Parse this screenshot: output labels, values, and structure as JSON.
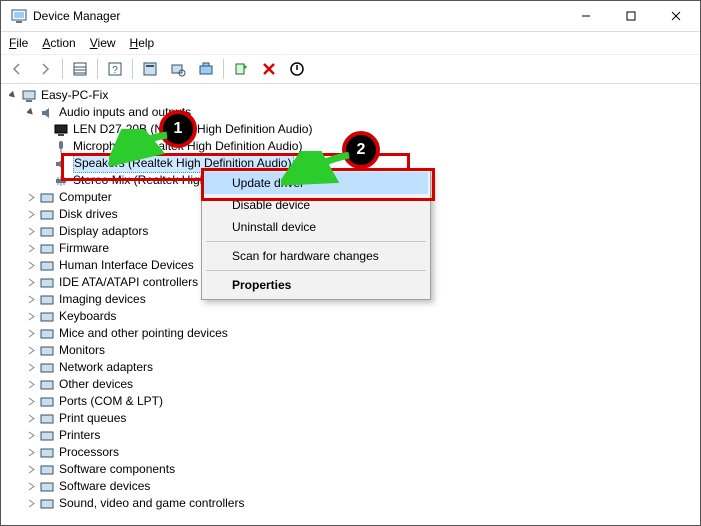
{
  "window": {
    "title": "Device Manager"
  },
  "menu": {
    "file": "File",
    "action": "Action",
    "view": "View",
    "help": "Help"
  },
  "tree": {
    "root": "Easy-PC-Fix",
    "audio_cat": "Audio inputs and outputs",
    "audio_children": [
      "LEN D27-20B (NVIDIA High Definition Audio)",
      "Microphone (Realtek High Definition Audio)",
      "Speakers (Realtek High Definition Audio)",
      "Stereo Mix (Realtek High Definition Audio)"
    ],
    "categories": [
      "Computer",
      "Disk drives",
      "Display adaptors",
      "Firmware",
      "Human Interface Devices",
      "IDE ATA/ATAPI controllers",
      "Imaging devices",
      "Keyboards",
      "Mice and other pointing devices",
      "Monitors",
      "Network adapters",
      "Other devices",
      "Ports (COM & LPT)",
      "Print queues",
      "Printers",
      "Processors",
      "Software components",
      "Software devices",
      "Sound, video and game controllers"
    ]
  },
  "context": {
    "update": "Update driver",
    "disable": "Disable device",
    "uninstall": "Uninstall device",
    "scan": "Scan for hardware changes",
    "properties": "Properties"
  },
  "annotations": {
    "step1": "1",
    "step2": "2"
  }
}
